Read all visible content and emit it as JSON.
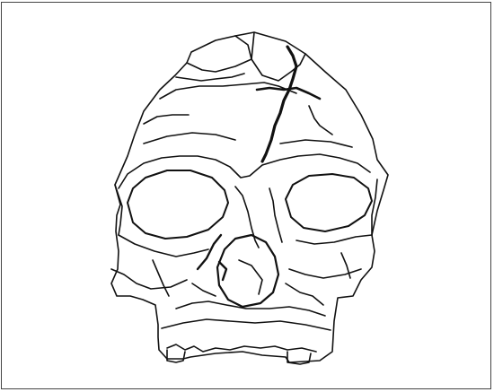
{
  "figure": {
    "subject_icon": "fossil-skull-frontal-view-drawing",
    "style": "black line drawing on white",
    "colors": {
      "ink": "#111111",
      "frame": "#444444",
      "background": "#ffffff"
    }
  }
}
